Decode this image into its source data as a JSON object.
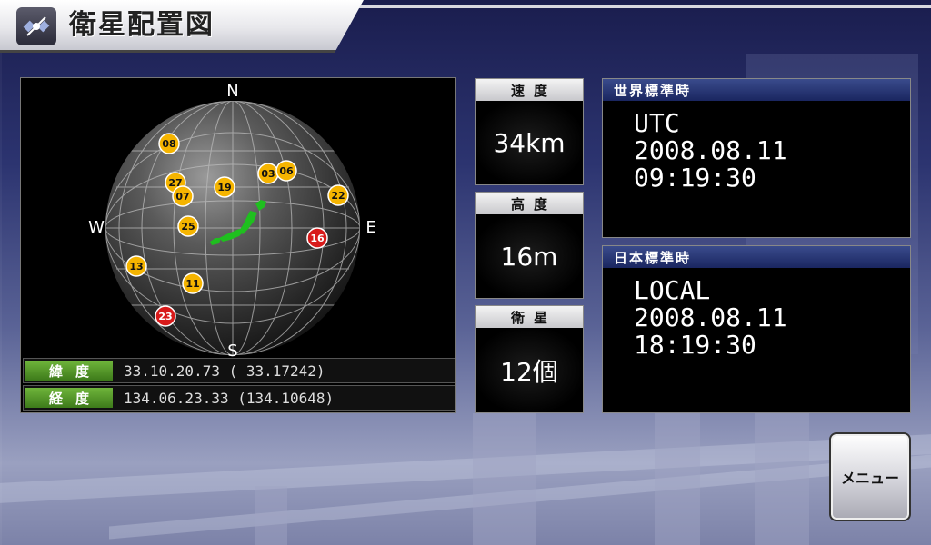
{
  "header": {
    "title": "衛星配置図"
  },
  "compass": {
    "north": "N",
    "south": "S",
    "east": "E",
    "west": "W"
  },
  "satellites": [
    {
      "id": "08",
      "color": "#f5b400"
    },
    {
      "id": "27",
      "color": "#f5b400"
    },
    {
      "id": "07",
      "color": "#f5b400"
    },
    {
      "id": "19",
      "color": "#f5b400"
    },
    {
      "id": "03",
      "color": "#f5b400"
    },
    {
      "id": "06",
      "color": "#f5b400"
    },
    {
      "id": "22",
      "color": "#f5b400"
    },
    {
      "id": "25",
      "color": "#f5b400"
    },
    {
      "id": "16",
      "color": "#d81a1a"
    },
    {
      "id": "13",
      "color": "#f5b400"
    },
    {
      "id": "11",
      "color": "#f5b400"
    },
    {
      "id": "23",
      "color": "#d81a1a"
    }
  ],
  "coordinates": {
    "latitude_label": "緯度",
    "latitude_value": "33.10.20.73 ( 33.17242)",
    "longitude_label": "経度",
    "longitude_value": "134.06.23.33 (134.10648)"
  },
  "stats": {
    "speed_label": "速度",
    "speed_value": "34km",
    "altitude_label": "高度",
    "altitude_value": "16m",
    "satellites_label": "衛星",
    "satellites_value": "12個"
  },
  "utc": {
    "label": "世界標準時",
    "zone": "UTC",
    "date": "2008.08.11",
    "time": "09:19:30"
  },
  "local": {
    "label": "日本標準時",
    "zone": "LOCAL",
    "date": "2008.08.11",
    "time": "18:19:30"
  },
  "menu": {
    "label": "メニュー"
  },
  "colors": {
    "accent_green": "#4f9a26",
    "sat_normal": "#f5b400",
    "sat_alert": "#d81a1a",
    "japan": "#1fbf1f"
  }
}
